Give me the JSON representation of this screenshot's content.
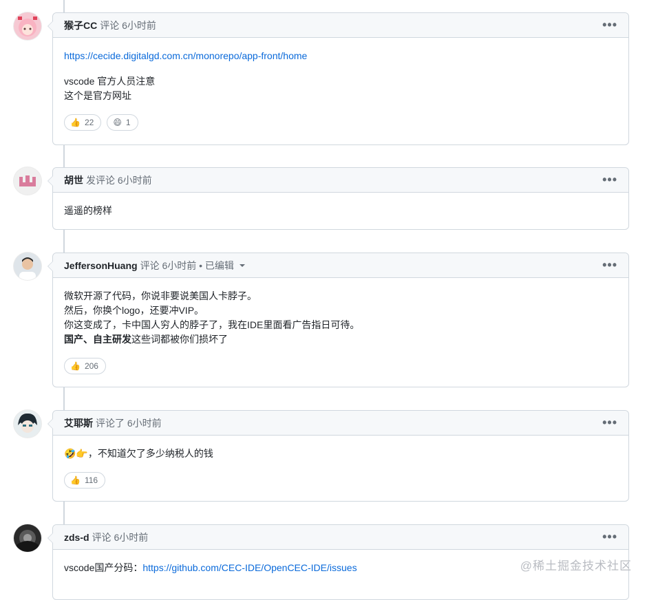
{
  "comments": [
    {
      "author": "猴子CC",
      "meta": "评论 6小时前",
      "link": "https://cecide.digitalgd.com.cn/monorepo/app-front/home",
      "lines": [
        "vscode 官方人员注意",
        "这个是官方网址"
      ],
      "reactions": [
        {
          "icon": "thumbs-up-icon",
          "emoji": "👍",
          "count": "22"
        },
        {
          "icon": "grinning-face-icon",
          "emoji": "😄",
          "count": "1"
        }
      ]
    },
    {
      "author": "胡世",
      "meta": "发评论 6小时前",
      "lines": [
        "遥遥的榜样"
      ]
    },
    {
      "author": "JeffersonHuang",
      "meta": "评论 6小时前 • 已编辑",
      "lines": [
        "微软开源了代码，你说非要说美国人卡脖子。",
        "然后，你换个logo，还要冲VIP。",
        "你这变成了，卡中国人穷人的脖子了，我在IDE里面看广告指日可待。"
      ],
      "bold_line": {
        "bold": "国产、自主研发",
        "rest": "这些词都被你们损坏了"
      },
      "reactions": [
        {
          "icon": "thumbs-up-icon",
          "emoji": "👍",
          "count": "206"
        }
      ]
    },
    {
      "author": "艾耶斯",
      "meta": "评论了 6小时前",
      "emoji_prefix": "🤣👉",
      "text": "，不知道欠了多少纳税人的钱",
      "reactions": [
        {
          "icon": "thumbs-up-icon",
          "emoji": "👍",
          "count": "116"
        }
      ]
    },
    {
      "author": "zds-d",
      "meta": "评论 6小时前",
      "prefix": "vscode国产分码：",
      "link": "https://github.com/CEC-IDE/OpenCEC-IDE/issues"
    }
  ],
  "more_label": "•••",
  "watermark": "@稀土掘金技术社区",
  "colors": {
    "link": "#0969da",
    "border": "#d0d7de",
    "header_bg": "#f6f8fa",
    "muted": "#656d76"
  }
}
